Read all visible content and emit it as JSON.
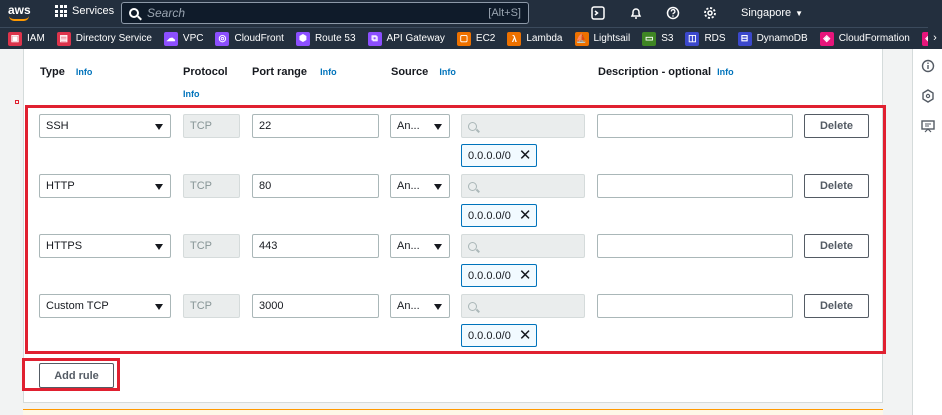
{
  "nav": {
    "services_label": "Services",
    "search_placeholder": "Search",
    "search_shortcut": "[Alt+S]",
    "region_label": "Singapore"
  },
  "favorites": [
    {
      "label": "IAM",
      "color": "#dd344c",
      "icon": "iam-icon"
    },
    {
      "label": "Directory Service",
      "color": "#dd344c",
      "icon": "directory-service-icon"
    },
    {
      "label": "VPC",
      "color": "#8c4fff",
      "icon": "vpc-icon"
    },
    {
      "label": "CloudFront",
      "color": "#8c4fff",
      "icon": "cloudfront-icon"
    },
    {
      "label": "Route 53",
      "color": "#8c4fff",
      "icon": "route53-icon"
    },
    {
      "label": "API Gateway",
      "color": "#8c4fff",
      "icon": "api-gateway-icon"
    },
    {
      "label": "EC2",
      "color": "#ed7100",
      "icon": "ec2-icon"
    },
    {
      "label": "Lambda",
      "color": "#ed7100",
      "icon": "lambda-icon"
    },
    {
      "label": "Lightsail",
      "color": "#ed7100",
      "icon": "lightsail-icon"
    },
    {
      "label": "S3",
      "color": "#3f8624",
      "icon": "s3-icon"
    },
    {
      "label": "RDS",
      "color": "#3b48cc",
      "icon": "rds-icon"
    },
    {
      "label": "DynamoDB",
      "color": "#3b48cc",
      "icon": "dynamodb-icon"
    },
    {
      "label": "CloudFormation",
      "color": "#e7157b",
      "icon": "cloudformation-icon"
    }
  ],
  "headers": {
    "type": "Type",
    "protocol": "Protocol",
    "port_range": "Port range",
    "source": "Source",
    "description": "Description - optional",
    "info": "Info"
  },
  "rules": [
    {
      "type": "SSH",
      "protocol": "TCP",
      "port": "22",
      "source_type": "An...",
      "cidr": "0.0.0.0/0",
      "description": "",
      "delete_label": "Delete"
    },
    {
      "type": "HTTP",
      "protocol": "TCP",
      "port": "80",
      "source_type": "An...",
      "cidr": "0.0.0.0/0",
      "description": "",
      "delete_label": "Delete"
    },
    {
      "type": "HTTPS",
      "protocol": "TCP",
      "port": "443",
      "source_type": "An...",
      "cidr": "0.0.0.0/0",
      "description": "",
      "delete_label": "Delete"
    },
    {
      "type": "Custom TCP",
      "protocol": "TCP",
      "port": "3000",
      "source_type": "An...",
      "cidr": "0.0.0.0/0",
      "description": "",
      "delete_label": "Delete"
    }
  ],
  "add_rule_label": "Add rule",
  "colors": {
    "highlight": "#e02030",
    "link": "#0073bb",
    "nav_bg": "#232f3e"
  }
}
